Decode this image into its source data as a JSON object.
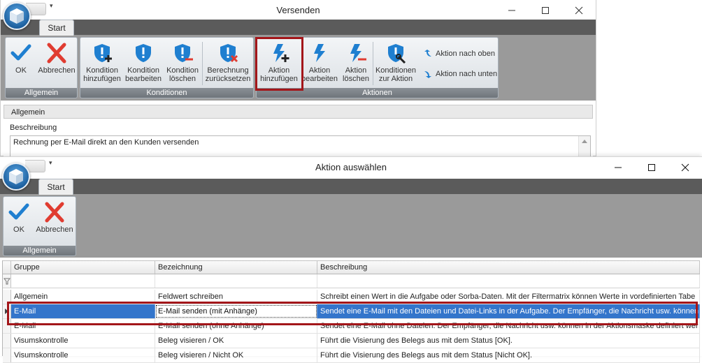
{
  "window1": {
    "title": "Versenden",
    "tab": "Start",
    "groups": {
      "allgemein": {
        "label": "Allgemein",
        "ok": "OK",
        "cancel": "Abbrechen"
      },
      "konditionen": {
        "label": "Konditionen",
        "add": [
          "Kondition",
          "hinzufügen"
        ],
        "edit": [
          "Kondition",
          "bearbeiten"
        ],
        "delete": [
          "Kondition",
          "löschen"
        ],
        "reset": [
          "Berechnung",
          "zurücksetzen"
        ]
      },
      "aktionen": {
        "label": "Aktionen",
        "add": [
          "Aktion",
          "hinzufügen"
        ],
        "edit": [
          "Aktion",
          "bearbeiten"
        ],
        "delete": [
          "Aktion",
          "löschen"
        ],
        "conditions": [
          "Konditionen",
          "zur Aktion"
        ],
        "up": "Aktion nach oben",
        "down": "Aktion nach unten"
      }
    },
    "panel": {
      "header": "Allgemein",
      "description_label": "Beschreibung",
      "description_value": "Rechnung per E-Mail direkt an den Kunden versenden"
    }
  },
  "window2": {
    "title": "Aktion auswählen",
    "tab": "Start",
    "group": {
      "label": "Allgemein",
      "ok": "OK",
      "cancel": "Abbrechen"
    },
    "table": {
      "columns": [
        "Gruppe",
        "Bezeichnung",
        "Beschreibung"
      ],
      "rows": [
        [
          "Allgemein",
          "Feldwert schreiben",
          "Schreibt einen Wert in die Aufgabe oder Sorba-Daten. Mit der Filtermatrix können Werte in vordefinierten Tabe"
        ],
        [
          "E-Mail",
          "E-Mail senden (mit Anhänge)",
          "Sendet eine E-Mail mit den Dateien und Datei-Links in der Aufgabe. Der Empfänger, die Nachricht usw. können i"
        ],
        [
          "E-Mail",
          "E-Mail senden (ohne Anhänge)",
          "Sendet eine E-Mail ohne Dateien. Der Empfänger, die Nachricht usw. können in der Aktionsmaske definiert wer"
        ],
        [
          "Visumskontrolle",
          "Beleg visieren / OK",
          "Führt die Visierung des Belegs aus mit dem Status [OK]."
        ],
        [
          "Visumskontrolle",
          "Beleg visieren / Nicht OK",
          "Führt die Visierung des Belegs aus mit dem Status [Nicht OK]."
        ]
      ],
      "selected_row": 1
    }
  },
  "colors": {
    "accent_blue": "#1f7fd0",
    "cancel_red": "#e03c31",
    "highlight": "#a3161a",
    "selection": "#3375cb"
  }
}
